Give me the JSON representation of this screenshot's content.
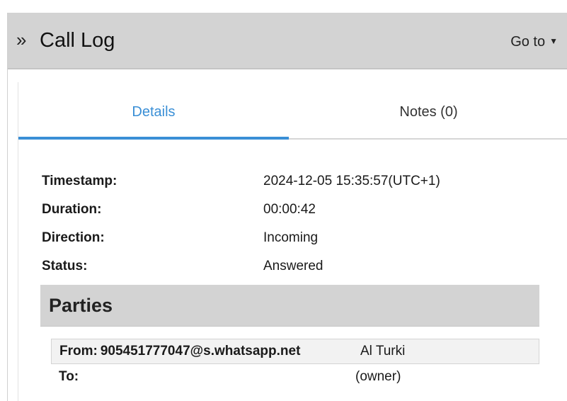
{
  "header": {
    "icon": "double-chevron-right-icon",
    "title": "Call Log",
    "goto_label": "Go to",
    "goto_icon": "caret-down-icon"
  },
  "tabs": [
    {
      "label": "Details",
      "active": true
    },
    {
      "label": "Notes (0)",
      "active": false
    }
  ],
  "details": [
    {
      "label": "Timestamp:",
      "value": "2024-12-05 15:35:57(UTC+1)"
    },
    {
      "label": "Duration:",
      "value": "00:00:42"
    },
    {
      "label": "Direction:",
      "value": "Incoming"
    },
    {
      "label": "Status:",
      "value": "Answered"
    }
  ],
  "parties": {
    "title": "Parties",
    "from": {
      "label": "From:",
      "address": "905451777047@s.whatsapp.net",
      "name": "Al Turki"
    },
    "to": {
      "label": "To:",
      "address": "",
      "name": "(owner)"
    }
  },
  "colors": {
    "accent": "#3a8fd6",
    "header_bg": "#d3d3d3"
  }
}
